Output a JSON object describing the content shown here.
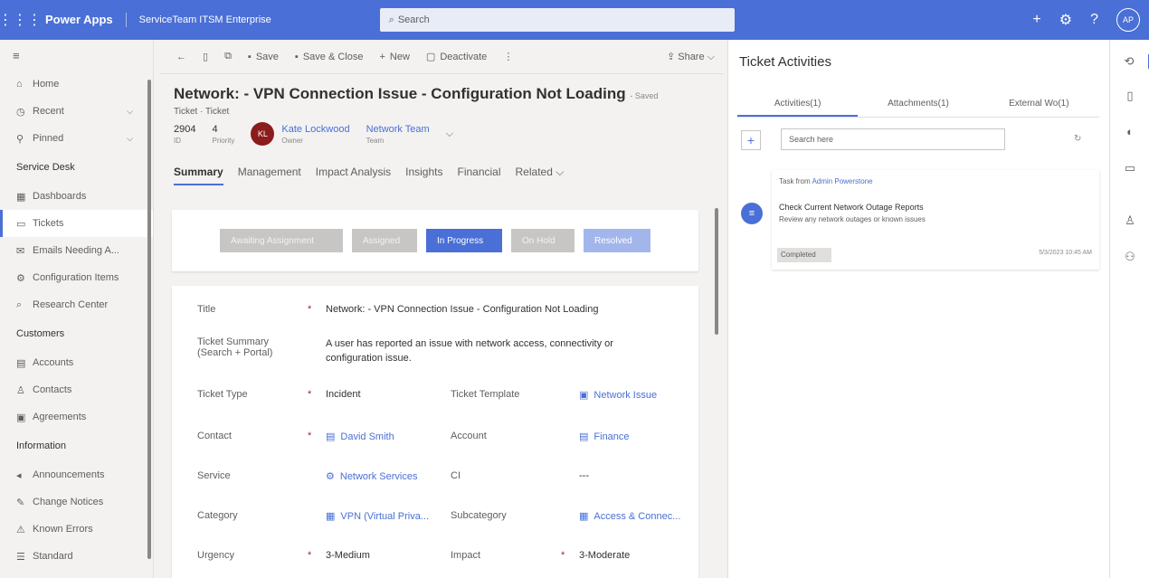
{
  "topbar": {
    "app_name": "Power Apps",
    "env_name": "ServiceTeam ITSM Enterprise",
    "search_placeholder": "Search",
    "avatar_initials": "AP"
  },
  "nav": {
    "items_top": [
      {
        "label": "Home"
      },
      {
        "label": "Recent",
        "chevron": "⌵"
      },
      {
        "label": "Pinned",
        "chevron": "⌵"
      }
    ],
    "section_service_desk": "Service Desk",
    "service_desk_items": [
      {
        "label": "Dashboards"
      },
      {
        "label": "Tickets"
      },
      {
        "label": "Emails Needing A..."
      },
      {
        "label": "Configuration Items"
      },
      {
        "label": "Research Center"
      }
    ],
    "section_customers": "Customers",
    "customers_items": [
      {
        "label": "Accounts"
      },
      {
        "label": "Contacts"
      },
      {
        "label": "Agreements"
      }
    ],
    "section_information": "Information",
    "information_items": [
      {
        "label": "Announcements"
      },
      {
        "label": "Change Notices"
      },
      {
        "label": "Known Errors"
      },
      {
        "label": "Standard"
      }
    ]
  },
  "commands": {
    "save": "Save",
    "save_close": "Save & Close",
    "new": "New",
    "deactivate": "Deactivate",
    "share": "Share"
  },
  "record": {
    "title": "Network: - VPN Connection Issue - Configuration Not Loading",
    "saved": "- Saved",
    "subtitle": "Ticket · Ticket",
    "id_value": "2904",
    "id_label": "ID",
    "priority_value": "4",
    "priority_label": "Priority",
    "owner_initials": "KL",
    "owner_name": "Kate Lockwood",
    "owner_label": "Owner",
    "team_name": "Network Team",
    "team_label": "Team"
  },
  "tabs": [
    "Summary",
    "Management",
    "Impact Analysis",
    "Insights",
    "Financial",
    "Related"
  ],
  "stages": [
    "Awaiting Assignment",
    "Assigned",
    "In Progress",
    "On Hold",
    "Resolved"
  ],
  "fields": {
    "title_label": "Title",
    "title_value": "Network: - VPN Connection Issue - Configuration Not Loading",
    "summary_label_1": "Ticket Summary",
    "summary_label_2": "(Search + Portal)",
    "summary_value_1": "A user has reported an issue with network access, connectivity or",
    "summary_value_2": "configuration issue.",
    "ticket_type_label": "Ticket Type",
    "ticket_type_value": "Incident",
    "ticket_template_label": "Ticket Template",
    "ticket_template_value": "Network Issue",
    "contact_label": "Contact",
    "contact_value": "David Smith",
    "account_label": "Account",
    "account_value": "Finance",
    "service_label": "Service",
    "service_value": "Network Services",
    "ci_label": "CI",
    "ci_value": "---",
    "category_label": "Category",
    "category_value": "VPN (Virtual Priva...",
    "subcategory_label": "Subcategory",
    "subcategory_value": "Access & Connec...",
    "urgency_label": "Urgency",
    "urgency_value": "3-Medium",
    "impact_label": "Impact",
    "impact_value": "3-Moderate"
  },
  "activities": {
    "panel_title": "Ticket Activities",
    "tabs": [
      "Activities(1)",
      "Attachments(1)",
      "External Wo(1)"
    ],
    "search_placeholder": "Search here",
    "from_prefix": "Task from",
    "from_name": "Admin Powerstone",
    "subject": "Check Current Network Outage Reports",
    "description": "Review any network outages or known issues",
    "status": "Completed",
    "date": "5/3/2023 10:45 AM"
  }
}
